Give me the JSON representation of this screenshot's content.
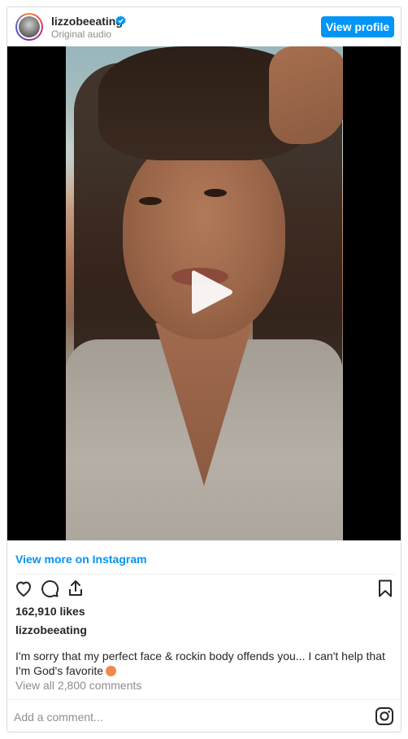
{
  "header": {
    "username": "lizzobeeating",
    "subtitle": "Original audio",
    "view_profile_label": "View profile",
    "verified_icon": "verified-badge-icon"
  },
  "media": {
    "type": "video",
    "play_icon": "play-icon"
  },
  "footer": {
    "view_more": "View more on Instagram",
    "likes": "162,910 likes",
    "caption_username": "lizzobeeating",
    "caption_text": "I'm sorry that my perfect face & rockin body offends you... I can't help that I'm God's favorite",
    "view_comments": "View all 2,800 comments",
    "comment_placeholder": "Add a comment...",
    "icons": [
      "heart-icon",
      "comment-icon",
      "share-icon",
      "bookmark-icon",
      "instagram-icon"
    ]
  },
  "colors": {
    "accent": "#0095f6",
    "text": "#262626",
    "muted": "#8e8e8e",
    "border": "#dbdbdb"
  }
}
